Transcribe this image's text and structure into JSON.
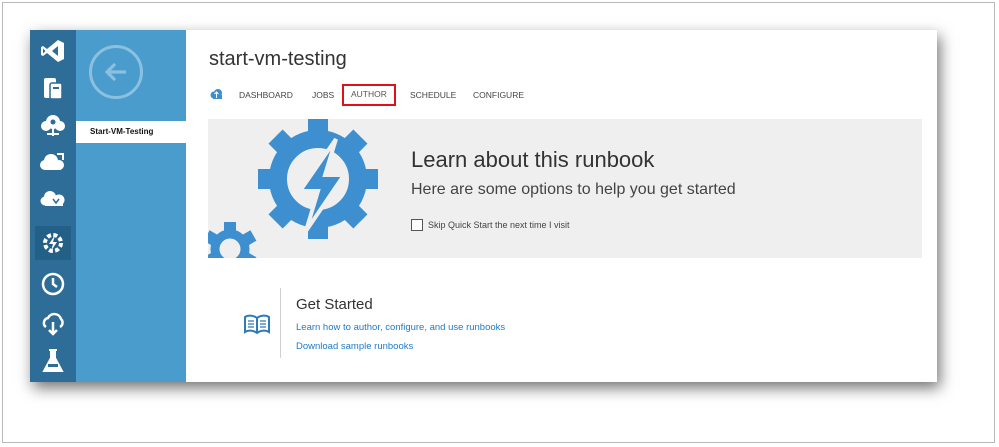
{
  "page": {
    "title": "start-vm-testing"
  },
  "nav": {
    "back_icon": "back-arrow-icon",
    "item_label": "Start-VM-Testing"
  },
  "sidebar_icons": [
    "visual-studio-icon",
    "mobile-services-icon",
    "cloud-services-icon",
    "virtual-machines-icon",
    "hdinsight-icon",
    "automation-icon",
    "scheduler-icon",
    "recovery-services-icon",
    "machine-learning-icon"
  ],
  "tabs": [
    {
      "label": "DASHBOARD"
    },
    {
      "label": "JOBS"
    },
    {
      "label": "AUTHOR"
    },
    {
      "label": "SCHEDULE"
    },
    {
      "label": "CONFIGURE"
    }
  ],
  "selected_tab": "AUTHOR",
  "banner": {
    "title": "Learn about this runbook",
    "subtitle": "Here are some options to help you get started",
    "skip_label": "Skip Quick Start the next time I visit",
    "skip_checked": false
  },
  "get_started": {
    "title": "Get Started",
    "links": [
      "Learn how to author, configure, and use runbooks",
      "Download sample runbooks"
    ]
  },
  "colors": {
    "icon_bar": "#2d6d98",
    "nav_panel": "#4a9ccc",
    "accent_blue": "#3d8fd0",
    "link": "#1f7ac6",
    "highlight_red": "#e0101a",
    "banner_bg": "#efefef"
  }
}
